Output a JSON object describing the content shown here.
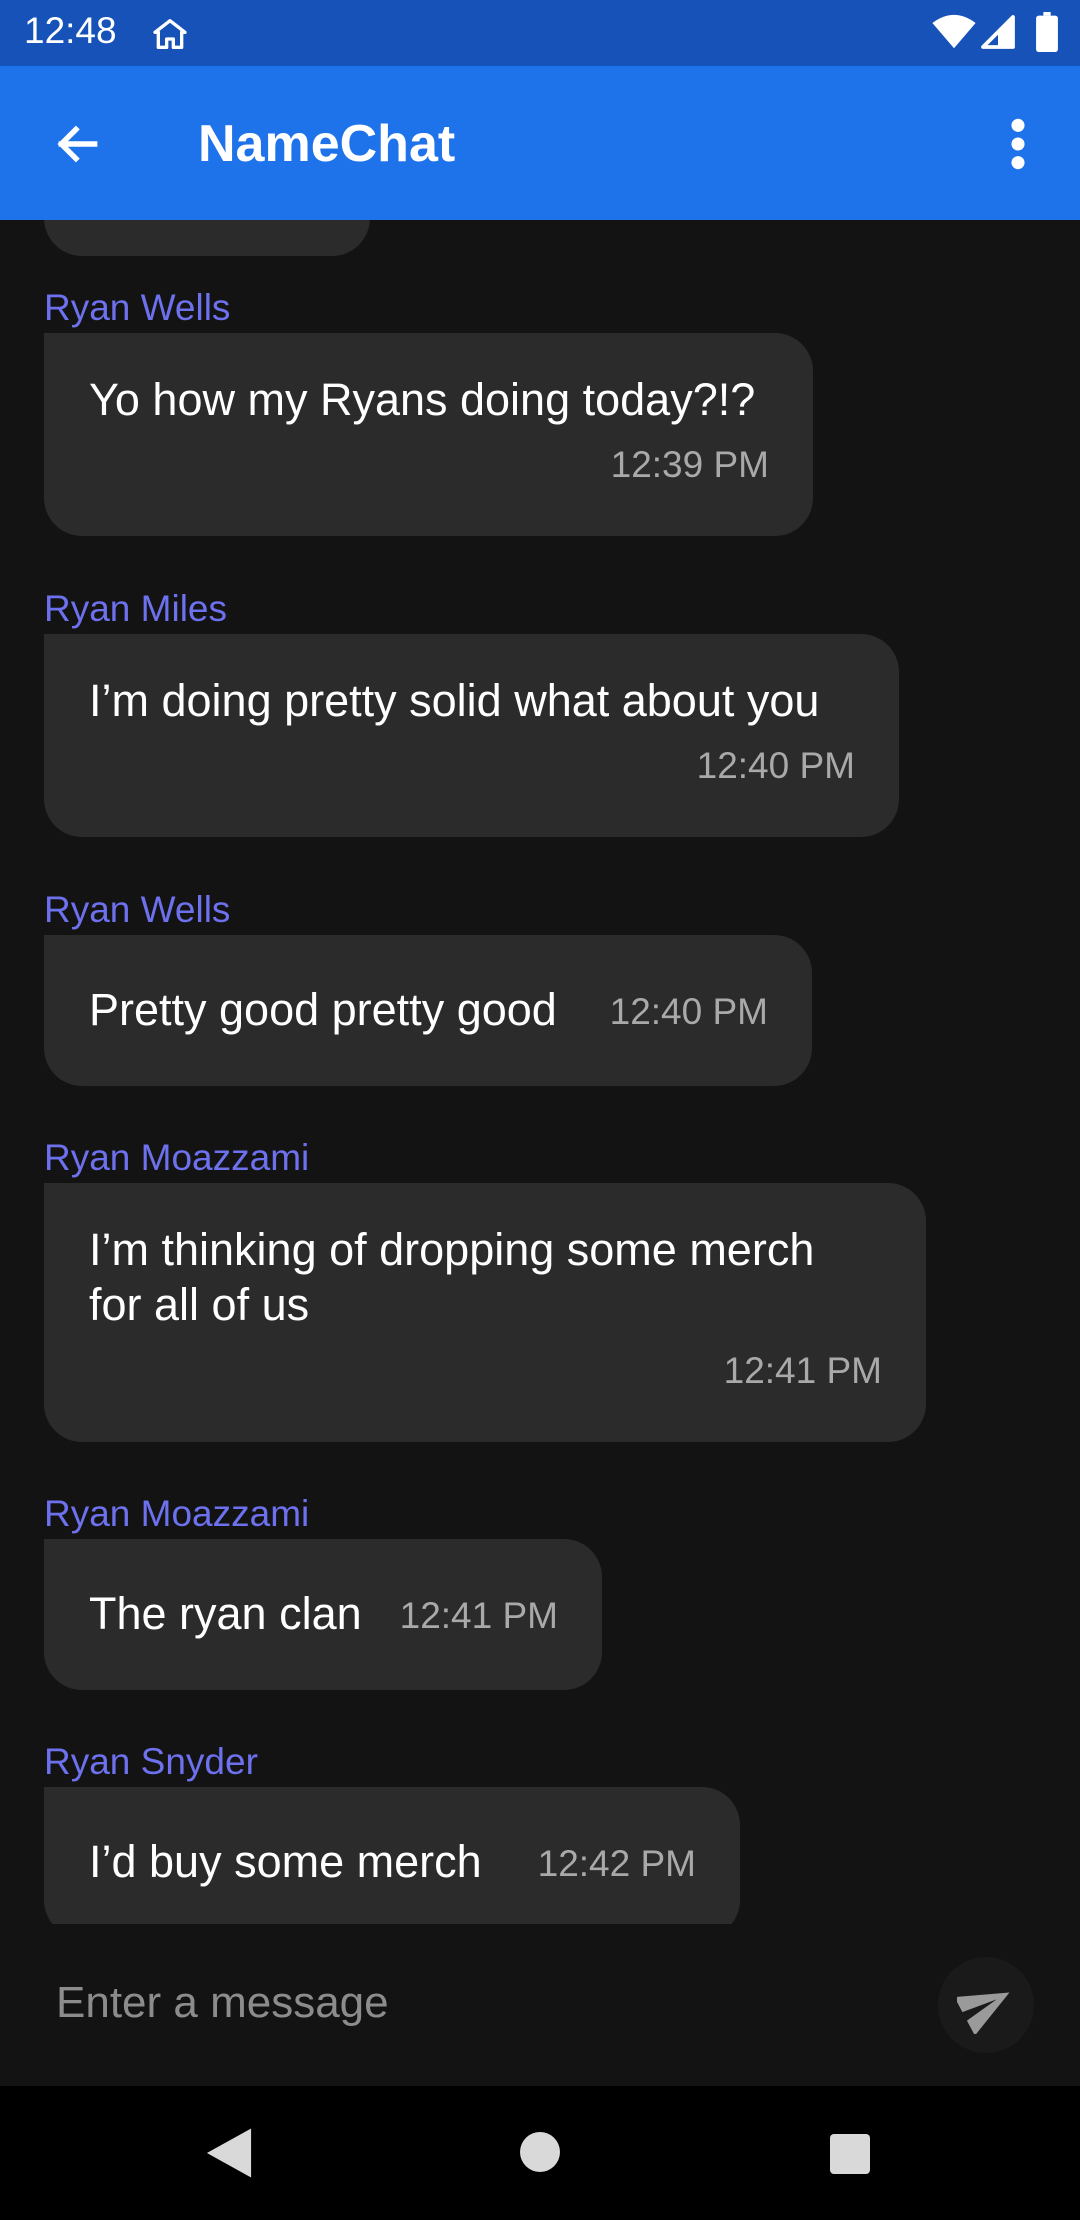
{
  "status_bar": {
    "time": "12:48",
    "icons": [
      "home-icon",
      "wifi-icon",
      "signal-icon",
      "battery-icon"
    ]
  },
  "app_bar": {
    "title": "NameChat",
    "back_icon": "arrow-left-icon",
    "menu_icon": "more-vert-icon",
    "color": "#1f73ea"
  },
  "messages": [
    {
      "sender": "Ryan Wells",
      "lines": [
        "Yo how my Ryans doing today?!?"
      ],
      "time": "12:39 PM"
    },
    {
      "sender": "Ryan Miles",
      "lines": [
        "I’m doing pretty solid what about you"
      ],
      "time": "12:40 PM"
    },
    {
      "sender": "Ryan Wells",
      "lines": [
        "Pretty good pretty good"
      ],
      "time": "12:40 PM"
    },
    {
      "sender": "Ryan Moazzami",
      "lines": [
        "I’m thinking of dropping some merch",
        "for all of us"
      ],
      "time": "12:41 PM"
    },
    {
      "sender": "Ryan Moazzami",
      "lines": [
        "The ryan clan"
      ],
      "time": "12:41 PM"
    },
    {
      "sender": "Ryan Snyder",
      "lines": [
        "I’d buy some merch"
      ],
      "time": "12:42 PM"
    }
  ],
  "composer": {
    "placeholder": "Enter a message",
    "send_icon": "send-icon"
  },
  "nav_bar": {
    "icons": [
      "nav-back-icon",
      "nav-home-icon",
      "nav-recents-icon"
    ]
  },
  "colors": {
    "background": "#131313",
    "bubble": "#2b2b2b",
    "sender_name": "#6d71ee",
    "timestamp": "#a9a9a9",
    "status_bar": "#1652b8"
  }
}
